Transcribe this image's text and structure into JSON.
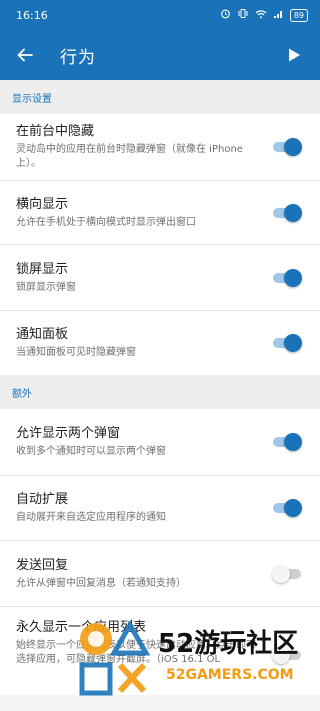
{
  "status": {
    "time": "16:16",
    "battery": "89"
  },
  "header": {
    "title": "行为"
  },
  "sections": {
    "display": {
      "label": "显示设置",
      "items": [
        {
          "title": "在前台中隐藏",
          "desc": "灵动岛中的应用在前台时隐藏弹窗（就像在 iPhone 上）。",
          "on": true
        },
        {
          "title": "横向显示",
          "desc": "允许在手机处于横向模式时显示弹出窗口",
          "on": true
        },
        {
          "title": "锁屏显示",
          "desc": "锁屏显示弹窗",
          "on": true
        },
        {
          "title": "通知面板",
          "desc": "当通知面板可见时隐藏弹窗",
          "on": true
        }
      ]
    },
    "extra": {
      "label": "额外",
      "items": [
        {
          "title": "允许显示两个弹窗",
          "desc": "收到多个通知时可以显示两个弹窗",
          "on": true
        },
        {
          "title": "自动扩展",
          "desc": "自动展开来自选定应用程序的通知",
          "on": true
        },
        {
          "title": "发送回复",
          "desc": "允许从弹窗中回复消息（若通知支持）",
          "on": false
        },
        {
          "title": "永久显示一个应用列表",
          "desc": "始终显示一个应用列表以便于快速启动应用。点击即可选择应用，可隐藏弹窗并截屏。（iOS 16.1 OL",
          "on": false
        }
      ]
    }
  },
  "watermark": {
    "main": "52游玩社区",
    "sub": "52GAMERS.COM"
  },
  "colors": {
    "primary": "#1a73b8",
    "track_on": "#9fc7e8",
    "watermark_accent": "#f39c12"
  }
}
